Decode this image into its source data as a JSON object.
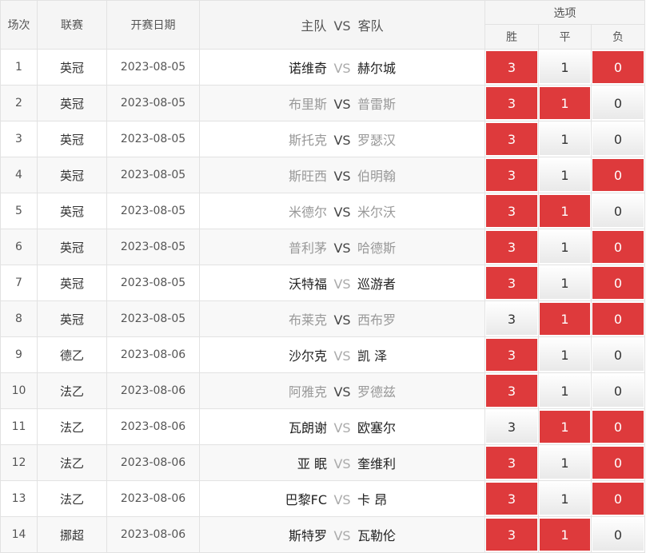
{
  "header": {
    "col_index": "场次",
    "col_league": "联赛",
    "col_date": "开赛日期",
    "col_home": "主队",
    "col_vs": "VS",
    "col_away": "客队",
    "col_options": "选项",
    "opt_win": "胜",
    "opt_draw": "平",
    "opt_lose": "负"
  },
  "colors": {
    "selected": "#de3a3c",
    "unselected": "#f3f3f3"
  },
  "rows": [
    {
      "idx": "1",
      "league": "英冠",
      "date": "2023-08-05",
      "home": "诺维奇",
      "vs": "VS",
      "away": "赫尔城",
      "home_dim": false,
      "vs_dim": true,
      "away_dim": false,
      "win": "3",
      "draw": "1",
      "lose": "0",
      "sel": {
        "win": true,
        "draw": false,
        "lose": true
      }
    },
    {
      "idx": "2",
      "league": "英冠",
      "date": "2023-08-05",
      "home": "布里斯",
      "vs": "VS",
      "away": "普雷斯",
      "home_dim": true,
      "vs_dim": false,
      "away_dim": true,
      "win": "3",
      "draw": "1",
      "lose": "0",
      "sel": {
        "win": true,
        "draw": true,
        "lose": false
      }
    },
    {
      "idx": "3",
      "league": "英冠",
      "date": "2023-08-05",
      "home": "斯托克",
      "vs": "VS",
      "away": "罗瑟汉",
      "home_dim": true,
      "vs_dim": false,
      "away_dim": true,
      "win": "3",
      "draw": "1",
      "lose": "0",
      "sel": {
        "win": true,
        "draw": false,
        "lose": false
      }
    },
    {
      "idx": "4",
      "league": "英冠",
      "date": "2023-08-05",
      "home": "斯旺西",
      "vs": "VS",
      "away": "伯明翰",
      "home_dim": true,
      "vs_dim": false,
      "away_dim": true,
      "win": "3",
      "draw": "1",
      "lose": "0",
      "sel": {
        "win": true,
        "draw": false,
        "lose": true
      }
    },
    {
      "idx": "5",
      "league": "英冠",
      "date": "2023-08-05",
      "home": "米德尔",
      "vs": "VS",
      "away": "米尔沃",
      "home_dim": true,
      "vs_dim": false,
      "away_dim": true,
      "win": "3",
      "draw": "1",
      "lose": "0",
      "sel": {
        "win": true,
        "draw": true,
        "lose": false
      }
    },
    {
      "idx": "6",
      "league": "英冠",
      "date": "2023-08-05",
      "home": "普利茅",
      "vs": "VS",
      "away": "哈德斯",
      "home_dim": true,
      "vs_dim": false,
      "away_dim": true,
      "win": "3",
      "draw": "1",
      "lose": "0",
      "sel": {
        "win": true,
        "draw": false,
        "lose": true
      }
    },
    {
      "idx": "7",
      "league": "英冠",
      "date": "2023-08-05",
      "home": "沃特福",
      "vs": "VS",
      "away": "巡游者",
      "home_dim": false,
      "vs_dim": true,
      "away_dim": false,
      "win": "3",
      "draw": "1",
      "lose": "0",
      "sel": {
        "win": true,
        "draw": false,
        "lose": true
      }
    },
    {
      "idx": "8",
      "league": "英冠",
      "date": "2023-08-05",
      "home": "布莱克",
      "vs": "VS",
      "away": "西布罗",
      "home_dim": true,
      "vs_dim": false,
      "away_dim": true,
      "win": "3",
      "draw": "1",
      "lose": "0",
      "sel": {
        "win": false,
        "draw": true,
        "lose": true
      }
    },
    {
      "idx": "9",
      "league": "德乙",
      "date": "2023-08-06",
      "home": "沙尔克",
      "vs": "VS",
      "away": "凯 泽",
      "home_dim": false,
      "vs_dim": true,
      "away_dim": false,
      "win": "3",
      "draw": "1",
      "lose": "0",
      "sel": {
        "win": true,
        "draw": false,
        "lose": false
      }
    },
    {
      "idx": "10",
      "league": "法乙",
      "date": "2023-08-06",
      "home": "阿雅克",
      "vs": "VS",
      "away": "罗德兹",
      "home_dim": true,
      "vs_dim": false,
      "away_dim": true,
      "win": "3",
      "draw": "1",
      "lose": "0",
      "sel": {
        "win": true,
        "draw": false,
        "lose": false
      }
    },
    {
      "idx": "11",
      "league": "法乙",
      "date": "2023-08-06",
      "home": "瓦朗谢",
      "vs": "VS",
      "away": "欧塞尔",
      "home_dim": false,
      "vs_dim": true,
      "away_dim": false,
      "win": "3",
      "draw": "1",
      "lose": "0",
      "sel": {
        "win": false,
        "draw": true,
        "lose": true
      }
    },
    {
      "idx": "12",
      "league": "法乙",
      "date": "2023-08-06",
      "home": "亚 眠",
      "vs": "VS",
      "away": "奎维利",
      "home_dim": false,
      "vs_dim": true,
      "away_dim": false,
      "win": "3",
      "draw": "1",
      "lose": "0",
      "sel": {
        "win": true,
        "draw": false,
        "lose": true
      }
    },
    {
      "idx": "13",
      "league": "法乙",
      "date": "2023-08-06",
      "home": "巴黎FC",
      "vs": "VS",
      "away": "卡 昂",
      "home_dim": false,
      "vs_dim": true,
      "away_dim": false,
      "win": "3",
      "draw": "1",
      "lose": "0",
      "sel": {
        "win": true,
        "draw": false,
        "lose": true
      }
    },
    {
      "idx": "14",
      "league": "挪超",
      "date": "2023-08-06",
      "home": "斯特罗",
      "vs": "VS",
      "away": "瓦勒伦",
      "home_dim": false,
      "vs_dim": true,
      "away_dim": false,
      "win": "3",
      "draw": "1",
      "lose": "0",
      "sel": {
        "win": true,
        "draw": true,
        "lose": false
      }
    }
  ]
}
